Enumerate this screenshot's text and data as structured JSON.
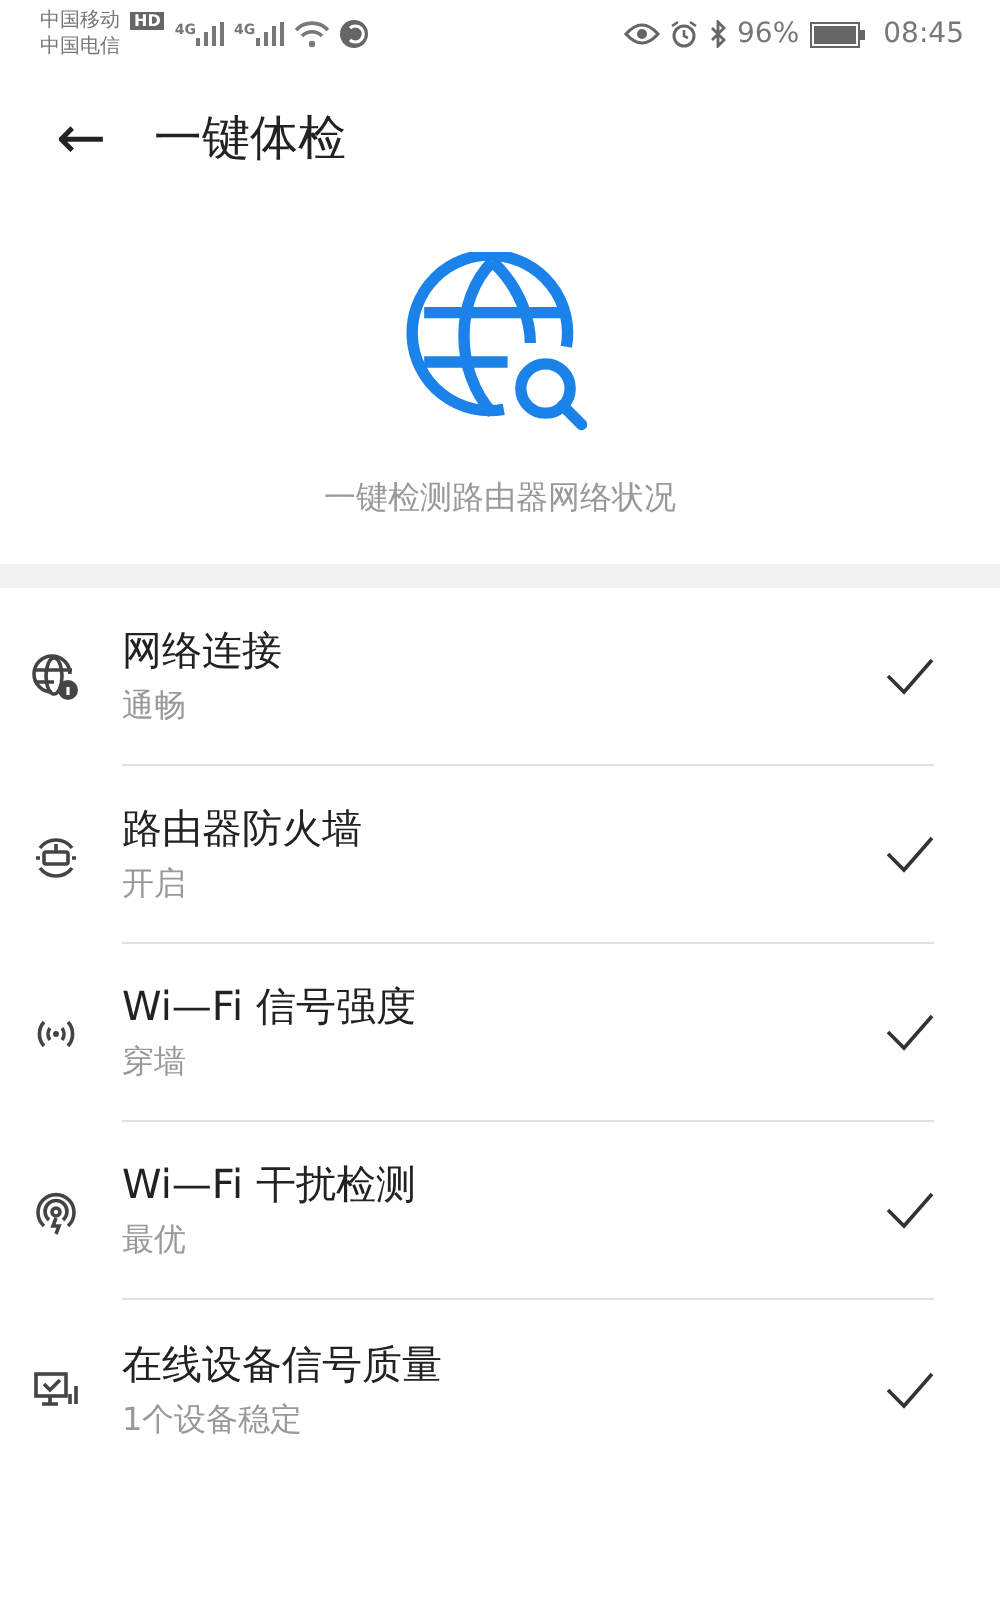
{
  "status_bar": {
    "carriers": [
      "中国移动",
      "中国电信"
    ],
    "hd_badge": "HD",
    "network_labels": [
      "4G",
      "4G"
    ],
    "battery_text": "96%",
    "time": "08:45"
  },
  "header": {
    "back": "←",
    "title": "一键体检"
  },
  "hero": {
    "subtitle": "一键检测路由器网络状况"
  },
  "checks": [
    {
      "kind": "globe",
      "title": "网络连接",
      "status": "通畅",
      "checked": true
    },
    {
      "kind": "router",
      "title": "路由器防火墙",
      "status": "开启",
      "checked": true
    },
    {
      "kind": "signal",
      "title": "Wi—Fi 信号强度",
      "status": "穿墙",
      "checked": true
    },
    {
      "kind": "interference",
      "title": "Wi—Fi 干扰检测",
      "status": "最优",
      "checked": true
    },
    {
      "kind": "device",
      "title": "在线设备信号质量",
      "status": "1个设备稳定",
      "checked": true
    }
  ]
}
